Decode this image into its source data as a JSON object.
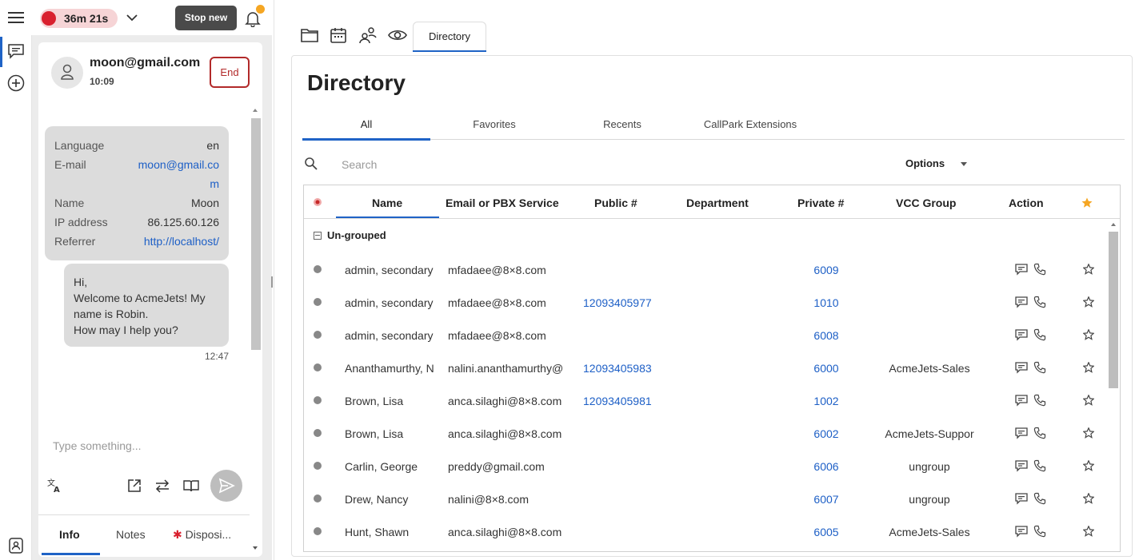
{
  "topbar": {
    "timer": "36m 21s",
    "stop_label": "Stop new"
  },
  "contact": {
    "email": "moon@gmail.com",
    "time": "10:09",
    "end_label": "End"
  },
  "info": [
    {
      "key": "Language",
      "value": "en"
    },
    {
      "key": "E-mail",
      "value": "moon@gmail.co"
    },
    {
      "key": "",
      "value": "m"
    },
    {
      "key": "Name",
      "value": "Moon"
    },
    {
      "key": "IP address",
      "value": "86.125.60.126"
    },
    {
      "key": "Referrer",
      "value": "http://localhost/"
    }
  ],
  "message": {
    "text": "Hi,\nWelcome to AcmeJets! My name is Robin.\nHow may I help you?",
    "time": "12:47"
  },
  "compose": {
    "placeholder": "Type something..."
  },
  "bottom_tabs": [
    "Info",
    "Notes",
    "Disposi..."
  ],
  "tabs": {
    "directory": "Directory"
  },
  "directory": {
    "title": "Directory",
    "subtabs": [
      "All",
      "Favorites",
      "Recents",
      "CallPark Extensions"
    ],
    "search_placeholder": "Search",
    "options_label": "Options",
    "columns": [
      "Name",
      "Email or PBX Service",
      "Public #",
      "Department",
      "Private #",
      "VCC Group",
      "Action"
    ],
    "group_label": "Un-grouped",
    "rows": [
      {
        "name": "admin, secondary",
        "email": "mfadaee@8×8.com",
        "public": "",
        "private": "6009",
        "vcc": ""
      },
      {
        "name": "admin, secondary",
        "email": "mfadaee@8×8.com",
        "public": "12093405977",
        "private": "1010",
        "vcc": ""
      },
      {
        "name": "admin, secondary",
        "email": "mfadaee@8×8.com",
        "public": "",
        "private": "6008",
        "vcc": ""
      },
      {
        "name": "Ananthamurthy, N",
        "email": "nalini.ananthamurthy@",
        "public": "12093405983",
        "private": "6000",
        "vcc": "AcmeJets-Sales"
      },
      {
        "name": "Brown, Lisa",
        "email": "anca.silaghi@8×8.com",
        "public": "12093405981",
        "private": "1002",
        "vcc": ""
      },
      {
        "name": "Brown, Lisa",
        "email": "anca.silaghi@8×8.com",
        "public": "",
        "private": "6002",
        "vcc": "AcmeJets-Suppor"
      },
      {
        "name": "Carlin, George",
        "email": "preddy@gmail.com",
        "public": "",
        "private": "6006",
        "vcc": "ungroup"
      },
      {
        "name": "Drew, Nancy",
        "email": "nalini@8×8.com",
        "public": "",
        "private": "6007",
        "vcc": "ungroup"
      },
      {
        "name": "Hunt, Shawn",
        "email": "anca.silaghi@8×8.com",
        "public": "",
        "private": "6005",
        "vcc": "AcmeJets-Sales"
      }
    ]
  },
  "colors": {
    "accent": "#1f63c6",
    "record": "#d9202e",
    "end": "#b22a2a",
    "star_header": "#f5a623"
  }
}
